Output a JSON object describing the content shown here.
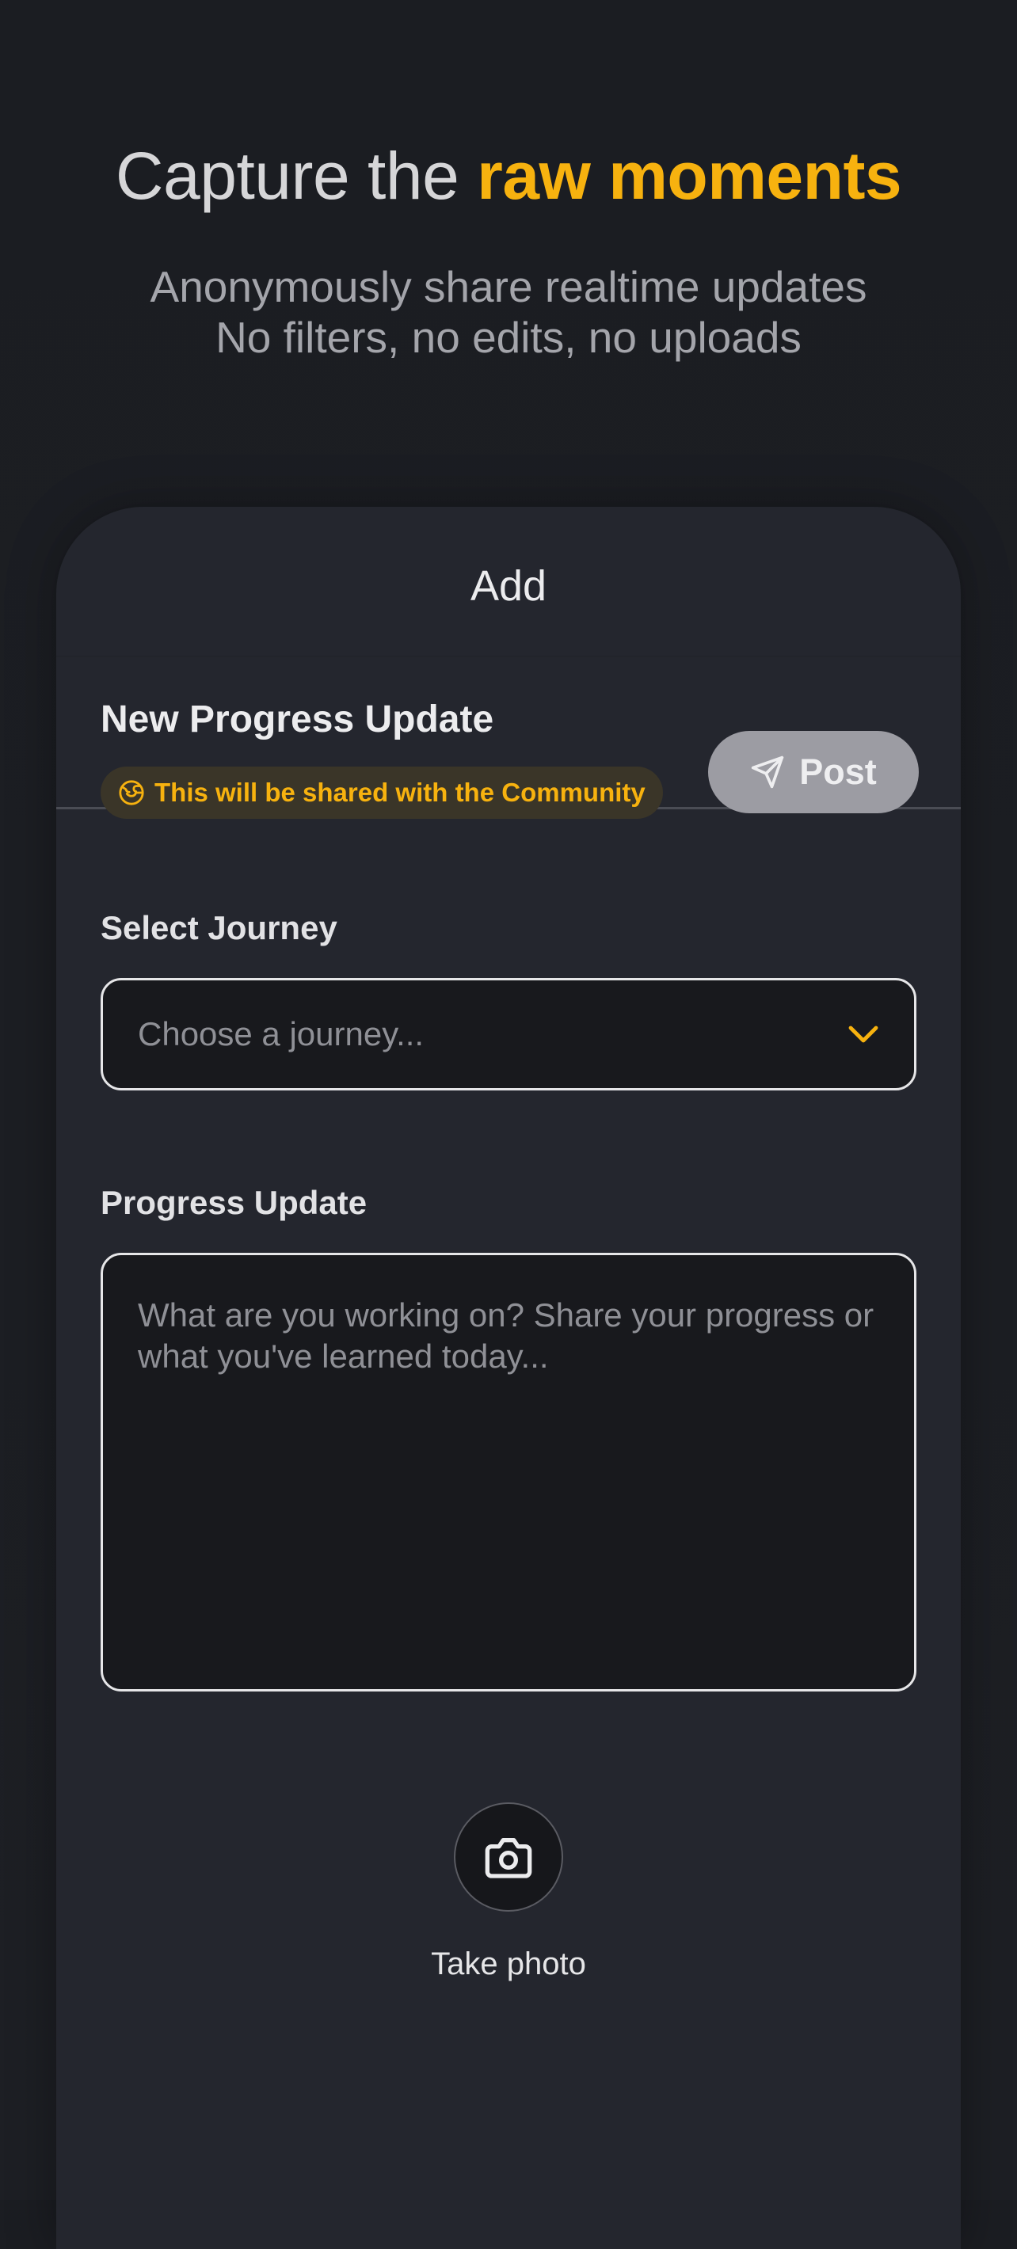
{
  "hero": {
    "title_prefix": "Capture the",
    "title_accent": "raw moments",
    "subtitle_line1": "Anonymously share realtime updates",
    "subtitle_line2": "No filters, no edits, no uploads"
  },
  "screen": {
    "header_title": "Add",
    "section_title": "New Progress Update",
    "community_notice": "This will be shared with the Community",
    "post_label": "Post"
  },
  "journey": {
    "label": "Select Journey",
    "placeholder": "Choose a journey..."
  },
  "progress": {
    "label": "Progress Update",
    "placeholder": "What are you working on? Share your progress or what you've learned today..."
  },
  "camera": {
    "label": "Take photo"
  },
  "colors": {
    "accent": "#f7b20f",
    "background": "#1c1e23",
    "card": "#24262e",
    "post_button": "#9c9ca3"
  },
  "icons": {
    "community": "globe-icon",
    "post": "send-icon",
    "select": "chevron-down-icon",
    "camera": "camera-icon"
  }
}
